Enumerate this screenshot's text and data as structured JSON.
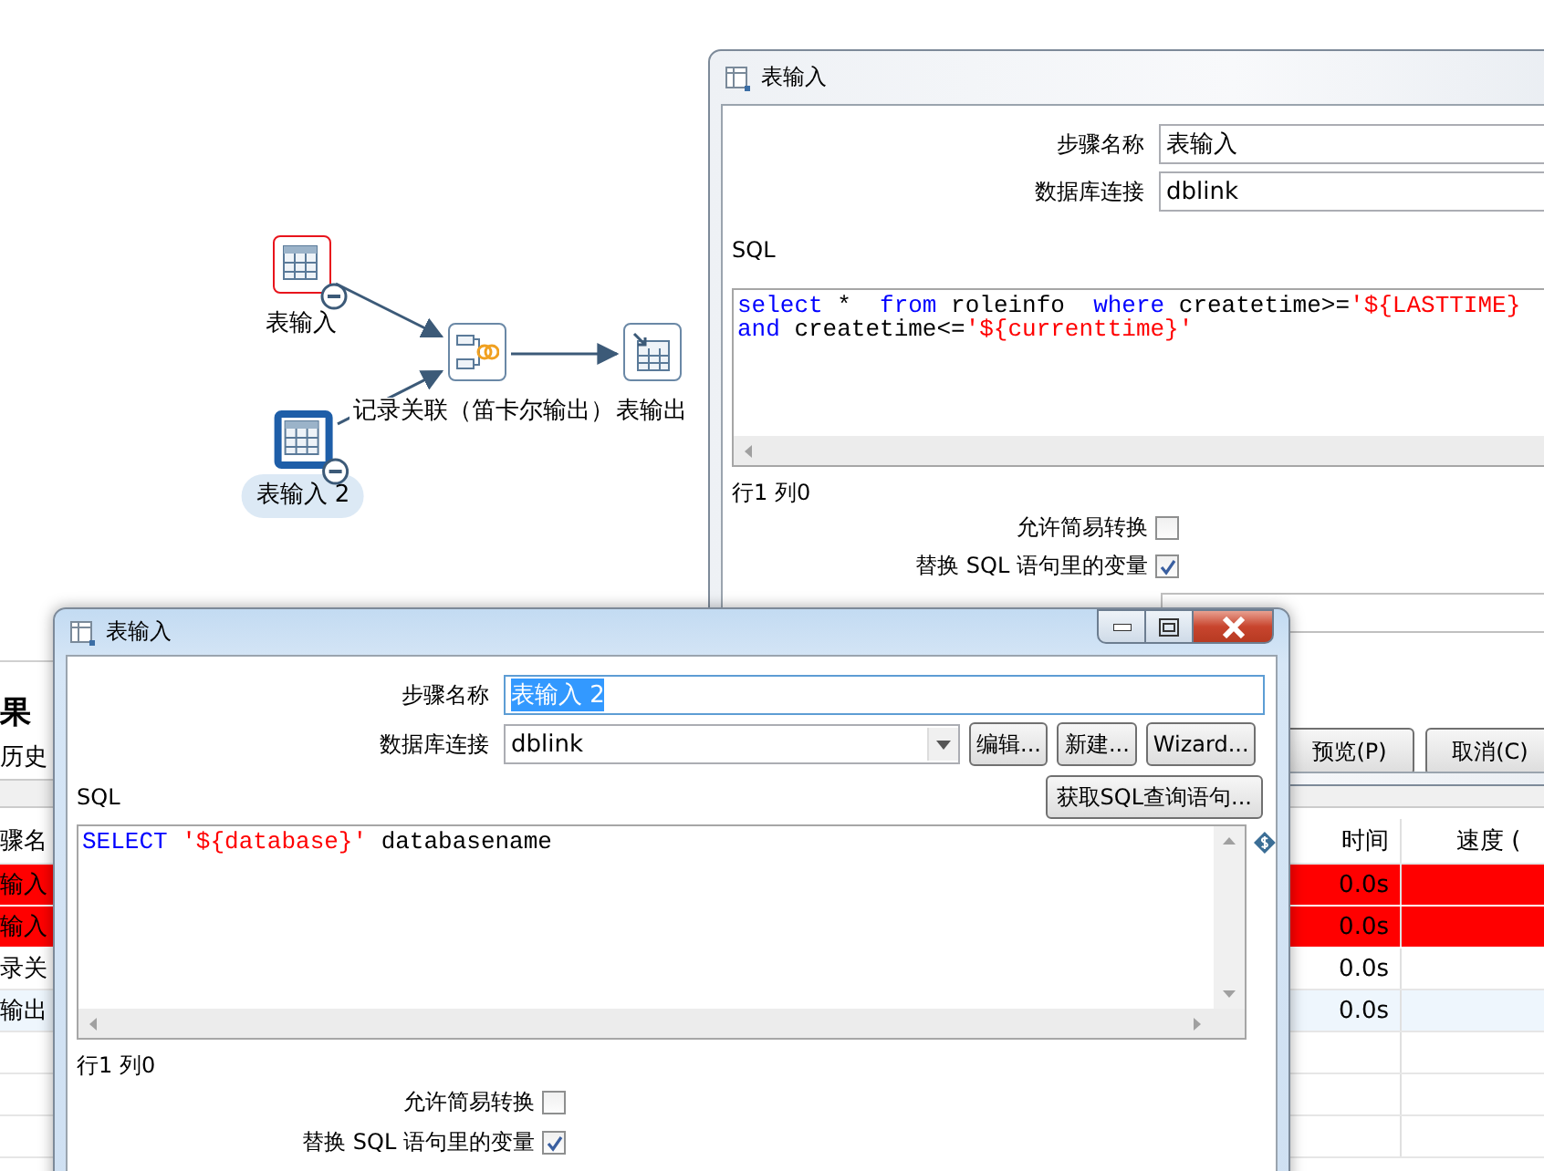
{
  "canvas": {
    "nodes": [
      {
        "label": "表输入",
        "kind": "input",
        "selected": false,
        "error": true
      },
      {
        "label": "表输入 2",
        "kind": "input",
        "selected": true,
        "error": false
      },
      {
        "label": "记录关联（笛卡尔输出）",
        "kind": "join",
        "selected": false,
        "error": false
      },
      {
        "label": "表输出",
        "kind": "output",
        "selected": false,
        "error": false
      }
    ]
  },
  "results": {
    "title": "果",
    "tab": "历史",
    "columns": [
      "骤名",
      "时间",
      "速度 ("
    ],
    "rows": [
      {
        "step": "输入",
        "time": "0.0s",
        "error": true
      },
      {
        "step": "输入",
        "time": "0.0s",
        "error": true
      },
      {
        "step": "录关",
        "time": "0.0s",
        "error": false
      },
      {
        "step": "输出",
        "time": "0.0s",
        "error": false
      }
    ]
  },
  "back_dialog": {
    "title": "表输入",
    "step_name_label": "步骤名称",
    "step_name": "表输入",
    "connection_label": "数据库连接",
    "connection": "dblink",
    "sql_label": "SQL",
    "sql_lines": [
      [
        {
          "text": "select",
          "kind": "keyword"
        },
        {
          "text": " *  ",
          "kind": "plain"
        },
        {
          "text": "from",
          "kind": "keyword"
        },
        {
          "text": " roleinfo  ",
          "kind": "plain"
        },
        {
          "text": "where",
          "kind": "keyword"
        },
        {
          "text": " createtime>=",
          "kind": "plain"
        },
        {
          "text": "'${LASTTIME}",
          "kind": "string"
        }
      ],
      [
        {
          "text": "and",
          "kind": "keyword"
        },
        {
          "text": " createtime<=",
          "kind": "plain"
        },
        {
          "text": "'${currenttime}'",
          "kind": "string"
        }
      ]
    ],
    "position": "行1 列0",
    "options": [
      {
        "label": "允许简易转换",
        "checked": false
      },
      {
        "label": "替换 SQL 语句里的变量",
        "checked": true
      }
    ],
    "buttons": [
      "预览(P)",
      "取消(C)"
    ]
  },
  "front_dialog": {
    "title": "表输入",
    "step_name_label": "步骤名称",
    "step_name": "表输入 2",
    "step_name_selected": true,
    "connection_label": "数据库连接",
    "connection": "dblink",
    "connection_buttons": [
      "编辑...",
      "新建...",
      "Wizard..."
    ],
    "sql_label": "SQL",
    "get_sql_button": "获取SQL查询语句...",
    "sql_lines": [
      [
        {
          "text": "SELECT",
          "kind": "keyword"
        },
        {
          "text": " '${database}'",
          "kind": "string"
        },
        {
          "text": " databasename",
          "kind": "plain"
        }
      ]
    ],
    "position": "行1 列0",
    "options": [
      {
        "label": "允许简易转换",
        "checked": false
      },
      {
        "label": "替换 SQL 语句里的变量",
        "checked": true
      }
    ]
  }
}
